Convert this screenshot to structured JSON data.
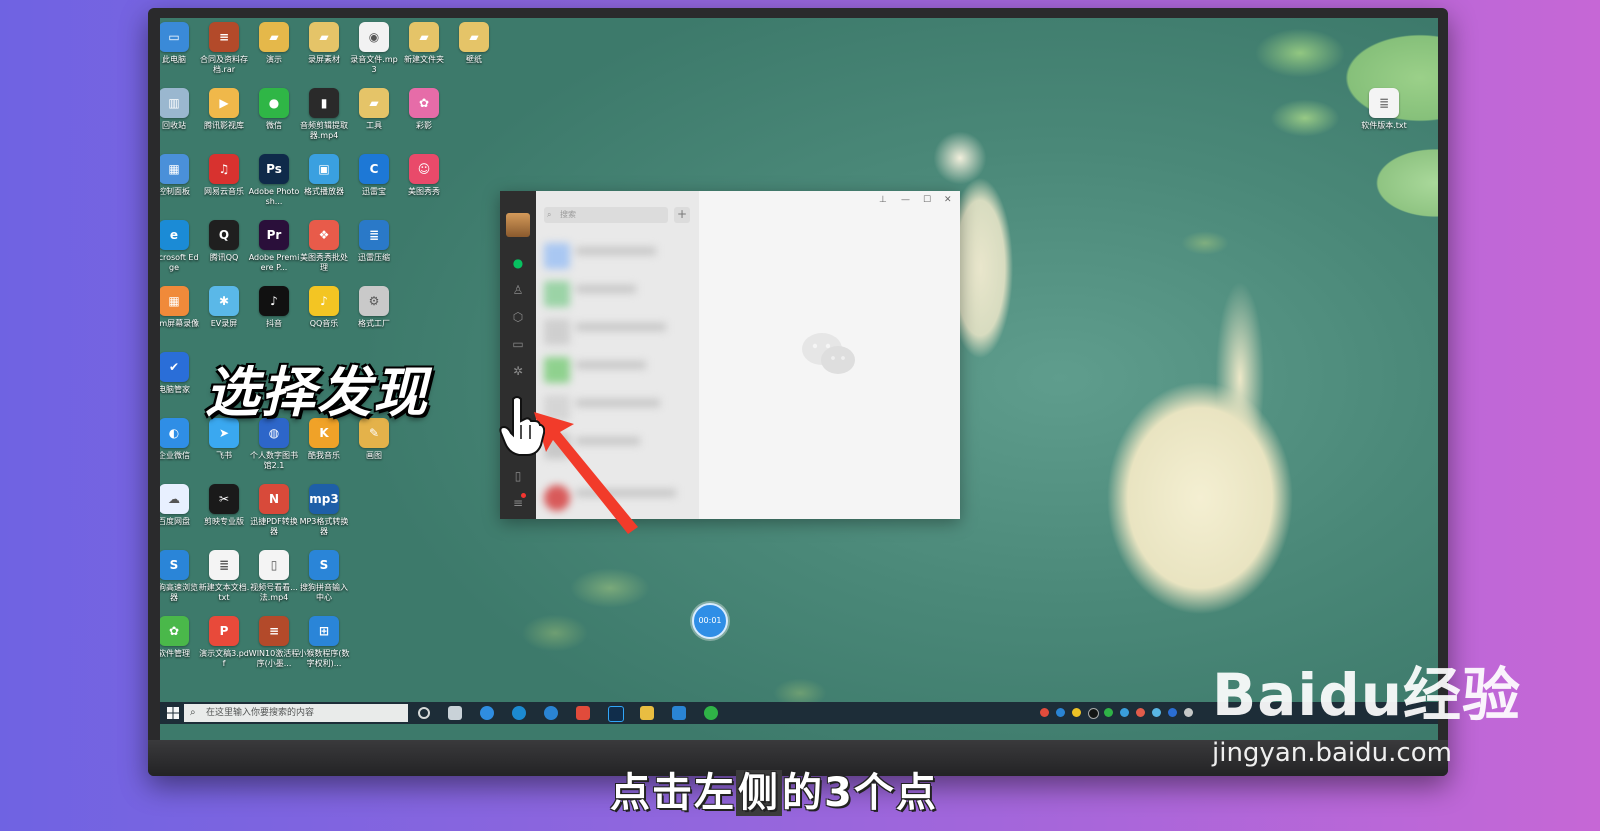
{
  "desktop_icons": [
    {
      "label": "此电脑",
      "color": "#3a8ad8",
      "glyph": "▭"
    },
    {
      "label": "合同及资料存档.rar",
      "color": "#b34a2a",
      "glyph": "≡"
    },
    {
      "label": "演示",
      "color": "#e5b84a",
      "glyph": "▰"
    },
    {
      "label": "录屏素材",
      "color": "#e5c468",
      "glyph": "▰"
    },
    {
      "label": "录音文件.mp3",
      "color": "#f2f2f2",
      "glyph": "◉"
    },
    {
      "label": "新建文件夹",
      "color": "#e5c468",
      "glyph": "▰"
    },
    {
      "label": "壁纸",
      "color": "#e5c468",
      "glyph": "▰"
    },
    {
      "label": "回收站",
      "color": "#9ab7cf",
      "glyph": "▥"
    },
    {
      "label": "腾讯影视库",
      "color": "#f0b84a",
      "glyph": "▶"
    },
    {
      "label": "微信",
      "color": "#2fb646",
      "glyph": "●"
    },
    {
      "label": "音频剪辑提取器.mp4",
      "color": "#2a2a2a",
      "glyph": "▮"
    },
    {
      "label": "工具",
      "color": "#e5c468",
      "glyph": "▰"
    },
    {
      "label": "彩影",
      "color": "#e66ca8",
      "glyph": "✿"
    },
    {
      "label": "控制面板",
      "color": "#4a90d9",
      "glyph": "▦"
    },
    {
      "label": "网易云音乐",
      "color": "#d8322f",
      "glyph": "♫"
    },
    {
      "label": "Adobe Photosh...",
      "color": "#0f2a4a",
      "glyph": "Ps"
    },
    {
      "label": "格式播放器",
      "color": "#3aa0e0",
      "glyph": "▣"
    },
    {
      "label": "迅雷宝",
      "color": "#1d78d6",
      "glyph": "C"
    },
    {
      "label": "美图秀秀",
      "color": "#e94a6a",
      "glyph": "☺"
    },
    {
      "label": "Microsoft Edge",
      "color": "#1b8bd6",
      "glyph": "e"
    },
    {
      "label": "腾讯QQ",
      "color": "#1f1f1f",
      "glyph": "Q"
    },
    {
      "label": "Adobe Premiere P...",
      "color": "#2a0f3a",
      "glyph": "Pr"
    },
    {
      "label": "美图秀秀批处理",
      "color": "#e85b4a",
      "glyph": "❖"
    },
    {
      "label": "迅雷压缩",
      "color": "#2a79c8",
      "glyph": "≣"
    },
    {
      "label": "Cam屏幕录像",
      "color": "#f08a3a",
      "glyph": "▦"
    },
    {
      "label": "EV录屏",
      "color": "#5ab8e8",
      "glyph": "✱"
    },
    {
      "label": "抖音",
      "color": "#111111",
      "glyph": "♪"
    },
    {
      "label": "QQ音乐",
      "color": "#f3c523",
      "glyph": "♪"
    },
    {
      "label": "格式工厂",
      "color": "#c9c9c9",
      "glyph": "⚙"
    },
    {
      "label": "电脑管家",
      "color": "#2a6ed8",
      "glyph": "✔"
    },
    {
      "label": "企业微信",
      "color": "#2f8ee6",
      "glyph": "◐"
    },
    {
      "label": "飞书",
      "color": "#3aa8f0",
      "glyph": "➤"
    },
    {
      "label": "个人数字图书馆2.1",
      "color": "#2d66c9",
      "glyph": "◍"
    },
    {
      "label": "酷我音乐",
      "color": "#f0a228",
      "glyph": "K"
    },
    {
      "label": "画图",
      "color": "#e4b24a",
      "glyph": "✎"
    },
    {
      "label": "百度网盘",
      "color": "#e8f0ff",
      "glyph": "☁"
    },
    {
      "label": "剪映专业版",
      "color": "#1a1a1a",
      "glyph": "✂"
    },
    {
      "label": "迅捷PDF转换器",
      "color": "#d84a3a",
      "glyph": "N"
    },
    {
      "label": "MP3格式转换器",
      "color": "#1e5fa8",
      "glyph": "mp3"
    },
    {
      "label": "搜狗高速浏览器",
      "color": "#2a85d8",
      "glyph": "S"
    },
    {
      "label": "新建文本文档.txt",
      "color": "#f4f4f4",
      "glyph": "≣"
    },
    {
      "label": "视频号看看...法.mp4",
      "color": "#f4f4f4",
      "glyph": "▯"
    },
    {
      "label": "搜狗拼音输入中心",
      "color": "#2a85d8",
      "glyph": "S"
    },
    {
      "label": "软件管理",
      "color": "#4ab84a",
      "glyph": "✿"
    },
    {
      "label": "演示文稿3.pdf",
      "color": "#e84a3a",
      "glyph": "P"
    },
    {
      "label": "WIN10激活程序(小墨...",
      "color": "#b34a2a",
      "glyph": "≡"
    },
    {
      "label": "小猴数程序(数字权利)...",
      "color": "#2a85d8",
      "glyph": "⊞"
    }
  ],
  "right_file": {
    "label": "软件版本.txt",
    "glyph": "≣"
  },
  "overlay_caption": "选择发现",
  "wechat": {
    "search_placeholder": "搜索",
    "add_button": "+",
    "controls": {
      "pin": "⊥",
      "minimize": "—",
      "maximize": "☐",
      "close": "✕"
    },
    "sidebar_icons": [
      "chat-icon",
      "contacts-icon",
      "favorites-icon",
      "files-icon",
      "moments-icon",
      "discover-icon",
      "phone-icon",
      "menu-icon"
    ]
  },
  "timer": "00:01",
  "taskbar": {
    "search_placeholder": "在这里输入你要搜索的内容",
    "tray_time": ""
  },
  "subtitle": {
    "before": "点击左",
    "highlight": "侧",
    "after": "的3个点"
  },
  "watermark": {
    "logo": "Baidu经验",
    "url": "jingyan.baidu.com"
  },
  "colors": {
    "wechat_green": "#07c160",
    "sidebar": "#2e2e2e",
    "taskbar": "#1c2a36",
    "timer": "#2f8ee6",
    "arrow": "#f23b2a"
  }
}
